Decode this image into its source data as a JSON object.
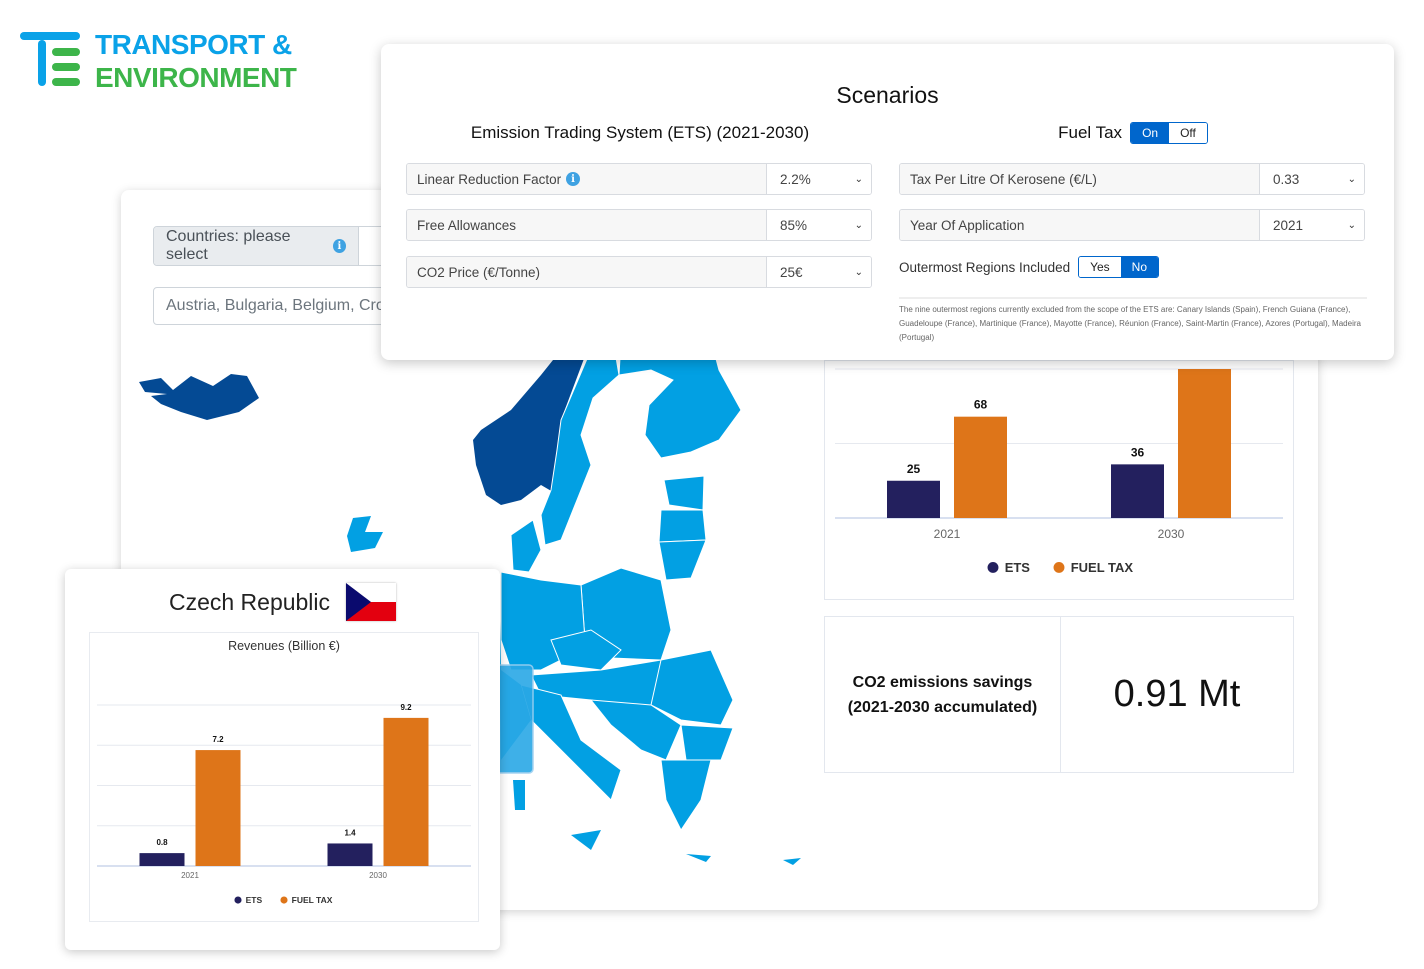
{
  "logo": {
    "line1": "TRANSPORT &",
    "line2": "ENVIRONMENT",
    "colors": {
      "blue": "#0aa2e8",
      "green": "#3db54a"
    }
  },
  "countries": {
    "label": "Countries: please select",
    "info_icon": "info-icon",
    "value": "Austria, Bulgaria, Belgium, Cro"
  },
  "scenarios": {
    "title": "Scenarios",
    "ets": {
      "title": "Emission Trading System (ETS) (2021-2030)",
      "fields": [
        {
          "label": "Linear Reduction Factor",
          "value": "2.2%",
          "has_info": true
        },
        {
          "label": "Free Allowances",
          "value": "85%"
        },
        {
          "label": "CO2 Price (€/Tonne)",
          "value": "25€"
        }
      ]
    },
    "fuel_tax": {
      "title": "Fuel Tax",
      "toggle": {
        "on": "On",
        "off": "Off",
        "selected": "On"
      },
      "fields": [
        {
          "label": "Tax Per Litre Of Kerosene (€/L)",
          "value": "0.33"
        },
        {
          "label": "Year Of Application",
          "value": "2021"
        }
      ],
      "outermost": {
        "label": "Outermost Regions Included",
        "yes": "Yes",
        "no": "No",
        "selected": "No"
      },
      "note": "The nine outermost regions currently excluded from the scope of the ETS are: Canary Islands (Spain), French Guiana (France), Guadeloupe (France), Martinique (France), Mayotte (France), Réunion (France), Saint-Martin (France), Azores (Portugal), Madeira (Portugal)"
    }
  },
  "stat": {
    "label_line1": "CO2 emissions savings",
    "label_line2": "(2021-2030 accumulated)",
    "value": "0.91 Mt"
  },
  "czech": {
    "country": "Czech Republic",
    "chart_title": "Revenues (Billion €)"
  },
  "colors": {
    "ets": "#23205e",
    "fuel_tax": "#de7519",
    "map_eu": "#02a0e3",
    "map_non_eu": "#044a94",
    "toggle_active": "#0066cc"
  },
  "chart_data": [
    {
      "type": "bar",
      "title": "",
      "categories": [
        "2021",
        "2030"
      ],
      "series": [
        {
          "name": "ETS",
          "values": [
            25,
            36
          ]
        },
        {
          "name": "FUEL TAX",
          "values": [
            68,
            100
          ]
        }
      ],
      "data_labels": [
        [
          "25",
          "36"
        ],
        [
          "68",
          ""
        ]
      ],
      "legend": [
        "ETS",
        "FUEL TAX"
      ],
      "legend_position": "bottom",
      "ylim": [
        0,
        100
      ],
      "grid": true
    },
    {
      "type": "bar",
      "title": "Revenues (Billion €)",
      "categories": [
        "2021",
        "2030"
      ],
      "series": [
        {
          "name": "ETS",
          "values": [
            0.8,
            1.4
          ]
        },
        {
          "name": "FUEL TAX",
          "values": [
            7.2,
            9.2
          ]
        }
      ],
      "legend": [
        "ETS",
        "FUEL TAX"
      ],
      "legend_position": "bottom",
      "ylim": [
        0,
        10
      ],
      "grid": true
    }
  ]
}
